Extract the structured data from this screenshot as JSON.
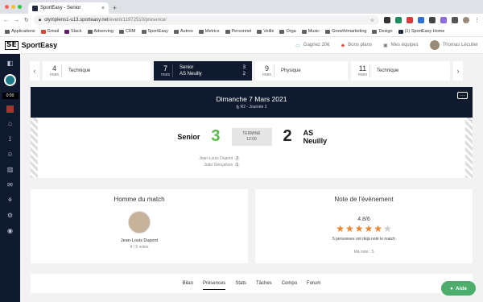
{
  "browser": {
    "tab_title": "SportEasy - Senior",
    "new_tab": "+",
    "url_domain": "olympiens1-u13.sporteasy.net",
    "url_path": "/event/11972510/presence/"
  },
  "bookmarks": [
    "Applications",
    "Gmail",
    "Slack",
    "Adserving",
    "CRM",
    "SportEasy",
    "Autres",
    "Metrics",
    "Personnel",
    "Veille",
    "Orga",
    "Music",
    "Growth/marketing",
    "Design",
    "(1) SportEasy Home"
  ],
  "header": {
    "logo": "SportEasy",
    "logo_mark": "SE",
    "earn": "Gagnez 20€",
    "deals": "Bons plans",
    "teams": "Mes équipes",
    "user": "Thomas Léculier"
  },
  "events": [
    {
      "day": "4",
      "month": "mars",
      "label": "Technique"
    },
    {
      "day": "7",
      "month": "mars",
      "home": "Senior",
      "home_score": "3",
      "away": "AS Neuilly",
      "away_score": "2"
    },
    {
      "day": "9",
      "month": "mars",
      "label": "Physique"
    },
    {
      "day": "11",
      "month": "mars",
      "label": "Technique"
    }
  ],
  "match": {
    "date": "Dimanche 7 Mars 2021",
    "round": "R2 - Journée 2",
    "home": "Senior",
    "home_score": "3",
    "away": "AS Neuilly",
    "away_score": "2",
    "status": "TERMINÉ",
    "time": "12:00",
    "more": "···",
    "scorers": [
      {
        "name": "Jean-Louis Dupont",
        "goals": "2"
      },
      {
        "name": "João Gonçalves",
        "goals": "1"
      }
    ]
  },
  "player_of_match": {
    "title": "Homme du match",
    "name": "Jean-Louis Dupont",
    "votes": "4 / 5 votes"
  },
  "rating": {
    "title": "Note de l'évènement",
    "value": "4.8/6",
    "stars_filled": 5,
    "stars_total": 6,
    "subtitle": "5 personnes ont déjà noté le match",
    "mine": "Ma note : 5"
  },
  "tabs": [
    "Bilan",
    "Présences",
    "Stats",
    "Tâches",
    "Compo",
    "Forum"
  ],
  "active_tab": "Présences",
  "help": "Aide",
  "colors": {
    "navy": "#0f1a2e",
    "win": "#58b947",
    "star": "#e8852e",
    "star_empty": "#cccccc",
    "help": "#4cae6a"
  }
}
